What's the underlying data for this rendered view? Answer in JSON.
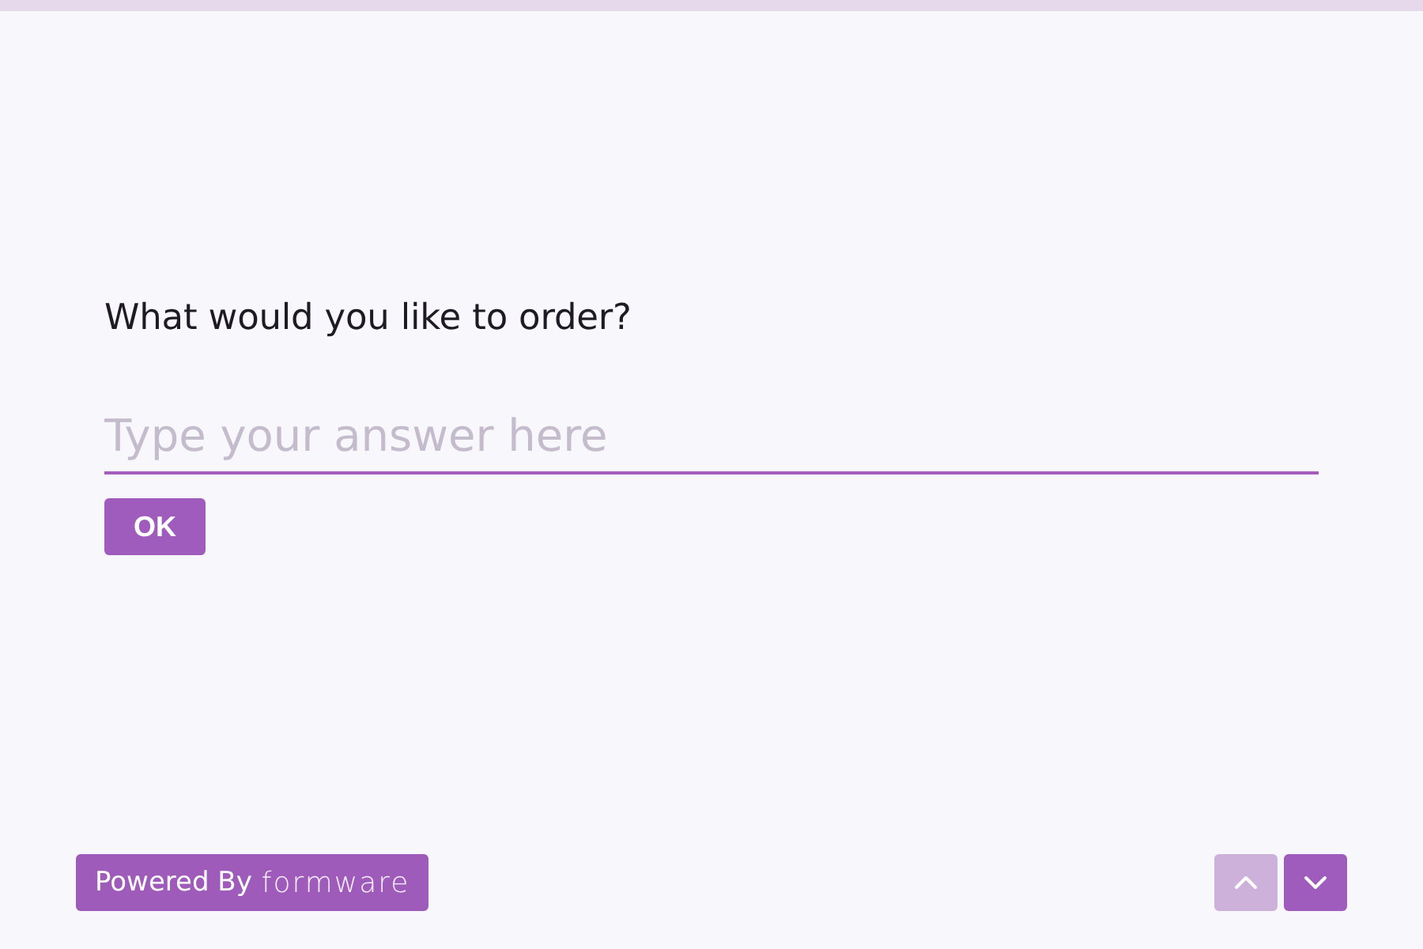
{
  "progress": {
    "level": 0
  },
  "question": {
    "title": "What would you like to order?",
    "placeholder": "Type your answer here",
    "submit": "OK"
  },
  "footer": {
    "powered_by": "Powered By",
    "brand": "formware"
  },
  "navigation": [
    {
      "kind": "up",
      "disabled": true
    },
    {
      "kind": "down",
      "disabled": false
    }
  ]
}
